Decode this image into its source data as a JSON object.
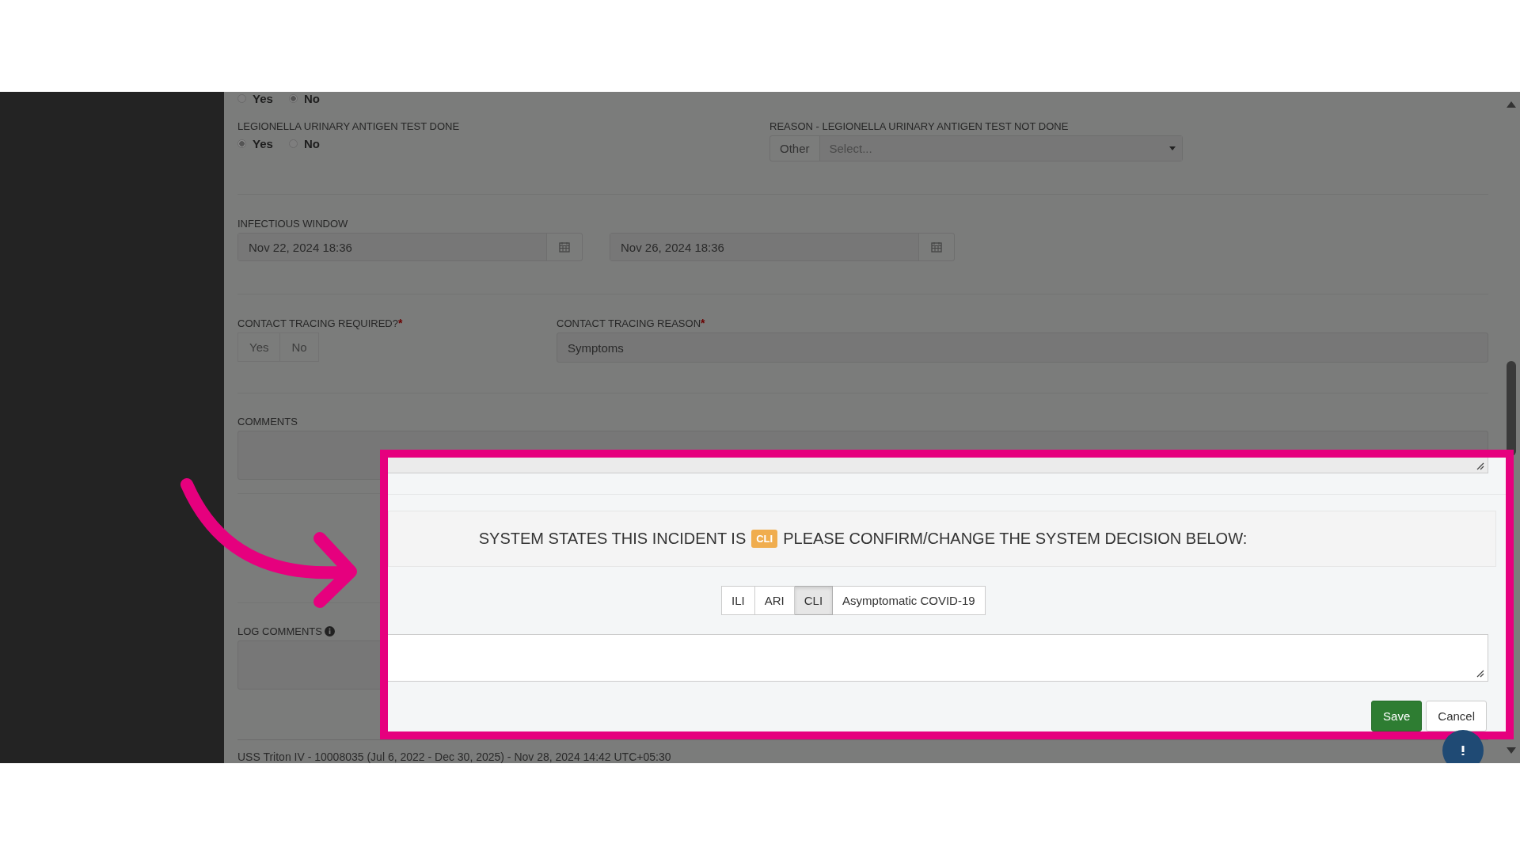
{
  "form": {
    "partial_radio": {
      "options": [
        {
          "label": "Yes",
          "selected": false
        },
        {
          "label": "No",
          "selected": true
        }
      ]
    },
    "legionella_test": {
      "label": "LEGIONELLA URINARY ANTIGEN TEST DONE",
      "options": [
        {
          "label": "Yes",
          "selected": true
        },
        {
          "label": "No",
          "selected": false
        }
      ]
    },
    "legionella_reason": {
      "label": "REASON - LEGIONELLA URINARY ANTIGEN TEST NOT DONE",
      "addon": "Other",
      "placeholder": "Select..."
    },
    "infectious_window": {
      "label": "INFECTIOUS WINDOW",
      "start": "Nov 22, 2024 18:36",
      "end": "Nov 26, 2024 18:36"
    },
    "contact_tracing_required": {
      "label": "CONTACT TRACING REQUIRED?",
      "required_mark": "*",
      "options": [
        {
          "label": "Yes",
          "selected": false
        },
        {
          "label": "No",
          "selected": false
        }
      ]
    },
    "contact_tracing_reason": {
      "label": "CONTACT TRACING REASON",
      "required_mark": "*",
      "value": "Symptoms"
    },
    "comments": {
      "label": "COMMENTS"
    },
    "log_comments": {
      "label": "LOG COMMENTS"
    }
  },
  "dialog": {
    "heading_before": "SYSTEM STATES THIS INCIDENT IS",
    "badge": "CLI",
    "heading_after": "PLEASE CONFIRM/CHANGE THE SYSTEM DECISION BELOW:",
    "options": [
      {
        "label": "ILI",
        "selected": false
      },
      {
        "label": "ARI",
        "selected": false
      },
      {
        "label": "CLI",
        "selected": true
      },
      {
        "label": "Asymptomatic COVID-19",
        "selected": false
      }
    ],
    "buttons": [
      {
        "label": "Save",
        "kind": "primary"
      },
      {
        "label": "Cancel",
        "kind": "default"
      }
    ]
  },
  "footer": "USS Triton IV - 10008035 (Jul 6, 2022 - Dec 30, 2025) - Nov 28, 2024 14:42 UTC+05:30"
}
